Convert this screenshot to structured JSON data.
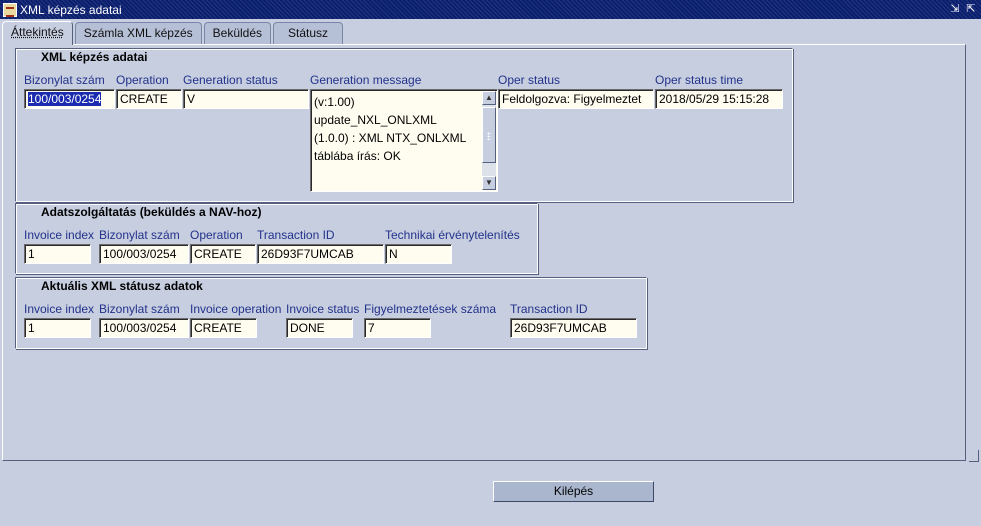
{
  "window": {
    "title": "XML képzés adatai",
    "controls": [
      "minimize-icon",
      "restore-icon"
    ]
  },
  "tabs": [
    {
      "label": "Áttekintés",
      "active": true
    },
    {
      "label": "Számla XML képzés",
      "active": false
    },
    {
      "label": "Beküldés",
      "active": false
    },
    {
      "label": "Státusz",
      "active": false
    }
  ],
  "xml_group": {
    "title": "XML képzés adatai",
    "labels": {
      "bizonylat_szam": "Bizonylat szám",
      "operation": "Operation",
      "generation_status": "Generation status",
      "generation_message": "Generation message",
      "oper_status": "Oper status",
      "oper_status_time": "Oper status time"
    },
    "values": {
      "bizonylat_szam": "100/003/0254",
      "operation": "CREATE",
      "generation_status": "V",
      "generation_message": "(v:1.00)\nupdate_NXL_ONLXML\n(1.0.0) : XML NTX_ONLXML\ntáblába írás: OK",
      "oper_status": "Feldolgozva: Figyelmeztet",
      "oper_status_time": "2018/05/29 15:15:28"
    }
  },
  "adatszolg_group": {
    "title": "Adatszolgáltatás (beküldés a NAV-hoz)",
    "labels": {
      "invoice_index": "Invoice index",
      "bizonylat_szam": "Bizonylat szám",
      "operation": "Operation",
      "transaction_id": "Transaction ID",
      "technikai": "Technikai érvénytelenítés"
    },
    "values": {
      "invoice_index": "1",
      "bizonylat_szam": "100/003/0254",
      "operation": "CREATE",
      "transaction_id": "26D93F7UMCAB",
      "technikai": "N"
    }
  },
  "statusz_group": {
    "title": "Aktuális XML státusz adatok",
    "labels": {
      "invoice_index": "Invoice index",
      "bizonylat_szam": "Bizonylat szám",
      "invoice_operation": "Invoice operation",
      "invoice_status": "Invoice status",
      "figyelmeztetesek": "Figyelmeztetések száma",
      "transaction_id": "Transaction ID"
    },
    "values": {
      "invoice_index": "1",
      "bizonylat_szam": "100/003/0254",
      "invoice_operation": "CREATE",
      "invoice_status": "DONE",
      "figyelmeztetesek": "7",
      "transaction_id": "26D93F7UMCAB"
    }
  },
  "footer": {
    "exit_label": "Kilépés"
  },
  "colors": {
    "titlebar": "#0a1e6e",
    "background": "#c6cee0",
    "label": "#23328a",
    "field_bg": "#fffdf0",
    "selection": "#1a2bb0"
  }
}
